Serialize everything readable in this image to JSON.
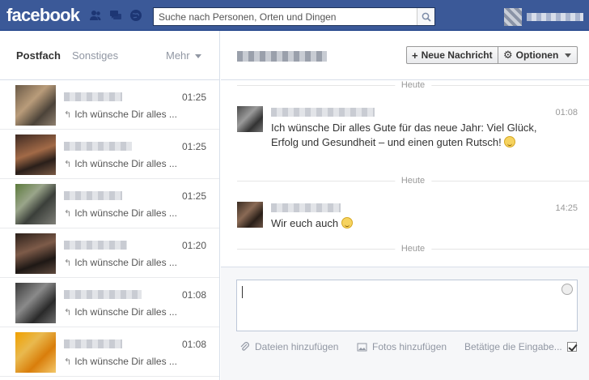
{
  "topbar": {
    "logo": "facebook",
    "search_placeholder": "Suche nach Personen, Orten und Dingen"
  },
  "left": {
    "tabs": {
      "inbox": "Postfach",
      "other": "Sonstiges",
      "more": "Mehr"
    },
    "conversations": [
      {
        "time": "01:25",
        "snippet": "Ich wünsche Dir alles ..."
      },
      {
        "time": "01:25",
        "snippet": "Ich wünsche Dir alles ..."
      },
      {
        "time": "01:25",
        "snippet": "Ich wünsche Dir alles ..."
      },
      {
        "time": "01:20",
        "snippet": "Ich wünsche Dir alles ..."
      },
      {
        "time": "01:08",
        "snippet": "Ich wünsche Dir alles ..."
      },
      {
        "time": "01:08",
        "snippet": "Ich wünsche Dir alles ..."
      }
    ]
  },
  "right": {
    "new_message": "Neue Nachricht",
    "options": "Optionen",
    "separator_label": "Heute",
    "messages": [
      {
        "time": "01:08",
        "text": "Ich wünsche Dir alles Gute für das neue Jahr: Viel Glück, Erfolg und Gesundheit – und einen guten Rutsch!"
      },
      {
        "time": "14:25",
        "text": "Wir euch auch"
      }
    ],
    "composer": {
      "add_files": "Dateien hinzufügen",
      "add_photos": "Fotos hinzufügen",
      "press_enter": "Betätige die Eingabe..."
    }
  }
}
